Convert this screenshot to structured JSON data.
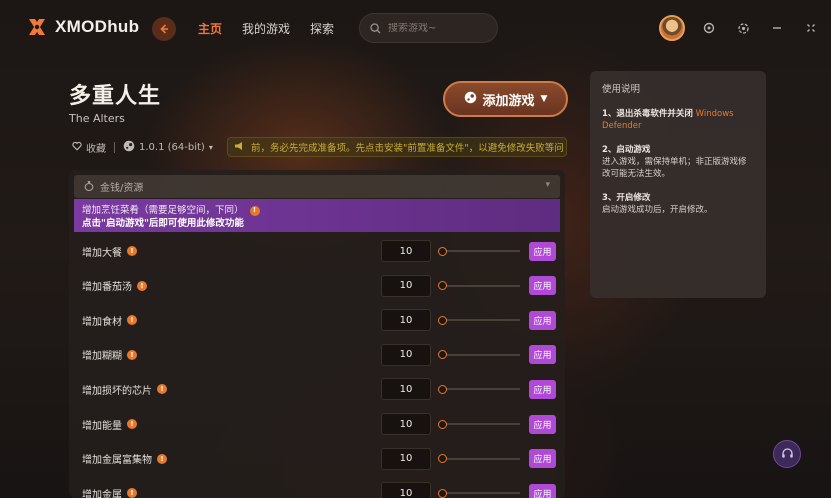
{
  "app": {
    "name": "XMODhub"
  },
  "nav": {
    "items": [
      "主页",
      "我的游戏",
      "探索"
    ]
  },
  "search": {
    "placeholder": "搜索游戏~"
  },
  "game": {
    "title": "多重人生",
    "subtitle": "The Alters",
    "favorite_label": "收藏",
    "version": "1.0.1 (64-bit)",
    "notice": "前，务必先完成准备项。先点击安装\"前置准备文件\"，以避免修改失败等问",
    "add_button": "添加游戏"
  },
  "panel": {
    "category": "金钱/资源",
    "tip_line1": "增加烹饪菜肴（需要足够空间，下同）",
    "tip_line2": "点击\"启动游戏\"后即可使用此修改功能",
    "rows": [
      {
        "label": "增加大餐",
        "value": "10",
        "apply": "应用"
      },
      {
        "label": "增加番茄汤",
        "value": "10",
        "apply": "应用"
      },
      {
        "label": "增加食材",
        "value": "10",
        "apply": "应用"
      },
      {
        "label": "增加糊糊",
        "value": "10",
        "apply": "应用"
      },
      {
        "label": "增加损坏的芯片",
        "value": "10",
        "apply": "应用"
      },
      {
        "label": "增加能量",
        "value": "10",
        "apply": "应用"
      },
      {
        "label": "增加金属富集物",
        "value": "10",
        "apply": "应用"
      },
      {
        "label": "增加金属",
        "value": "10",
        "apply": "应用"
      }
    ]
  },
  "guide": {
    "title": "使用说明",
    "step1_title": "1、退出杀毒软件并关闭",
    "step1_highlight": "Windows Defender",
    "step2_title": "2、启动游戏",
    "step2_body": "进入游戏，需保持单机；非正版游戏修改可能无法生效。",
    "step3_title": "3、开启修改",
    "step3_body": "启动游戏成功后，开启修改。"
  },
  "colors": {
    "accent": "#f07838",
    "apply": "#b04ad6",
    "tip": "#7a3aa0"
  }
}
